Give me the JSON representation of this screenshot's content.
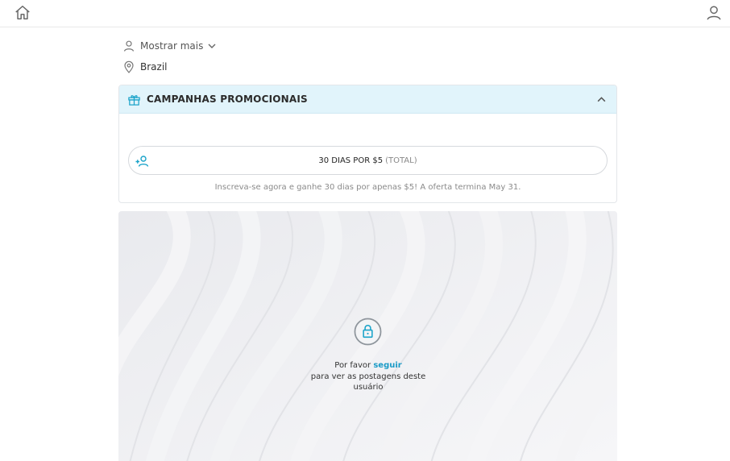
{
  "header": {
    "home_icon": "home-icon",
    "user_icon": "user-icon"
  },
  "profile": {
    "show_more_label": "Mostrar mais",
    "location": "Brazil"
  },
  "promo": {
    "title": "CAMPANHAS PROMOCIONAIS",
    "offer_label": "30 DIAS POR $5",
    "offer_suffix": "(TOTAL)",
    "offer_note": "Inscreva-se agora e ganhe 30 dias por apenas $5! A oferta termina May 31.",
    "accent_color": "#1aa3c9",
    "header_bg": "#e1f4fb"
  },
  "locked": {
    "prefix": "Por favor",
    "follow_link": "seguir",
    "message": "para ver as postagens deste usuário"
  }
}
